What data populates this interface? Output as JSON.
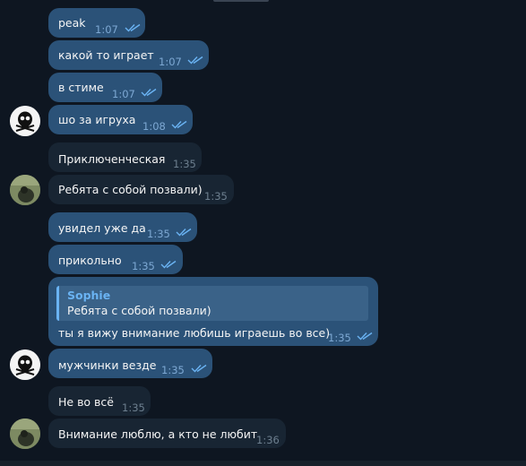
{
  "messages": [
    {
      "text": "peak",
      "time": "1:07",
      "dir": "out"
    },
    {
      "text": "какой то играет",
      "time": "1:07",
      "dir": "out"
    },
    {
      "text": "в стиме",
      "time": "1:07",
      "dir": "out"
    },
    {
      "text": "шо за игруха",
      "time": "1:08",
      "dir": "out"
    },
    {
      "text": "Приключенческая",
      "time": "1:35",
      "dir": "in"
    },
    {
      "text": "Ребята с собой позвали)",
      "time": "1:35",
      "dir": "in"
    },
    {
      "text": "увидел уже да",
      "time": "1:35",
      "dir": "out"
    },
    {
      "text": "прикольно",
      "time": "1:35",
      "dir": "out"
    },
    {
      "text": "ты я вижу внимание любишь играешь во все)",
      "time": "1:35",
      "dir": "out",
      "reply": {
        "name": "Sophie",
        "text": "Ребята с собой позвали)"
      }
    },
    {
      "text": "мужчинки везде",
      "time": "1:35",
      "dir": "out"
    },
    {
      "text": "Не во всё",
      "time": "1:35",
      "dir": "in"
    },
    {
      "text": "Внимание люблю, а кто не любит",
      "time": "1:36",
      "dir": "in"
    }
  ],
  "colors": {
    "background": "#0e1621",
    "outgoing_bubble": "#2b5278",
    "incoming_bubble": "#182533",
    "accent": "#6ab3f3"
  }
}
